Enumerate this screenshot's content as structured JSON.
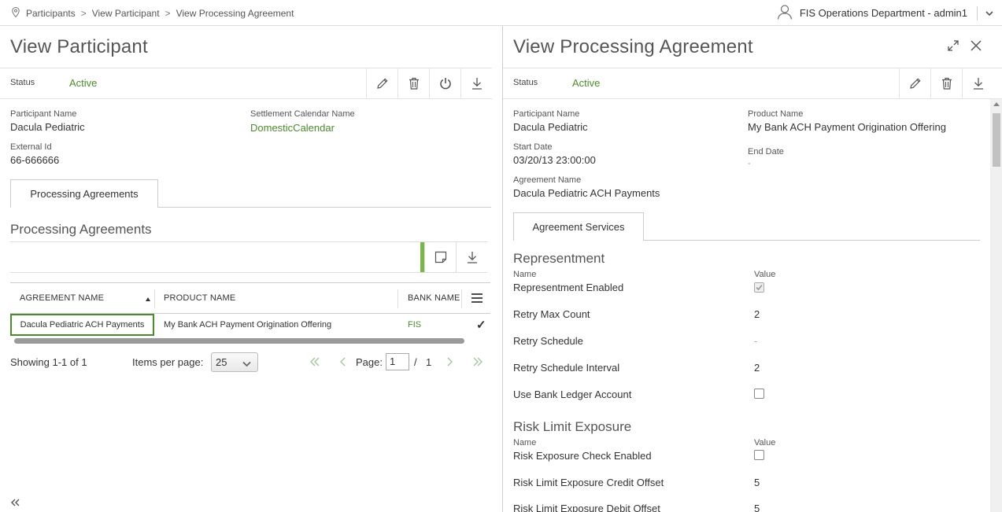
{
  "breadcrumb": [
    "Participants",
    "View Participant",
    "View Processing Agreement"
  ],
  "user": {
    "label": "FIS Operations Department - admin1"
  },
  "left": {
    "title": "View Participant",
    "status_label": "Status",
    "status_value": "Active",
    "participant_name_label": "Participant Name",
    "participant_name": "Dacula Pediatric",
    "settlement_calendar_label": "Settlement Calendar Name",
    "settlement_calendar": "DomesticCalendar",
    "external_id_label": "External Id",
    "external_id": "66-666666",
    "tab": "Processing Agreements",
    "section_title": "Processing Agreements",
    "grid": {
      "columns": [
        "AGREEMENT NAME",
        "PRODUCT NAME",
        "BANK NAME"
      ],
      "rows": [
        {
          "agreement_name": "Dacula Pediatric ACH Payments",
          "product_name": "My Bank ACH Payment Origination Offering",
          "bank_name": "FIS",
          "checked": "✓"
        }
      ]
    },
    "pager": {
      "showing": "Showing 1-1 of 1",
      "items_per_page_label": "Items per page:",
      "items_per_page": "25",
      "page_label": "Page:",
      "page": "1",
      "slash": "/",
      "total_pages": "1"
    }
  },
  "right": {
    "title": "View Processing Agreement",
    "status_label": "Status",
    "status_value": "Active",
    "participant_name_label": "Participant Name",
    "participant_name": "Dacula Pediatric",
    "product_name_label": "Product Name",
    "product_name": "My Bank ACH Payment Origination Offering",
    "start_date_label": "Start Date",
    "start_date": "03/20/13 23:00:00",
    "end_date_label": "End Date",
    "end_date": "-",
    "agreement_name_label": "Agreement Name",
    "agreement_name": "Dacula Pediatric ACH Payments",
    "tab": "Agreement Services",
    "representment": {
      "title": "Representment",
      "name_header": "Name",
      "value_header": "Value",
      "rows": [
        {
          "name": "Representment Enabled",
          "value": "",
          "checkbox": true,
          "checked": true
        },
        {
          "name": "Retry Max Count",
          "value": "2"
        },
        {
          "name": "Retry Schedule",
          "value": "-"
        },
        {
          "name": "Retry Schedule Interval",
          "value": "2"
        },
        {
          "name": "Use Bank Ledger Account",
          "value": "",
          "checkbox": true,
          "checked": false
        }
      ]
    },
    "risk": {
      "title": "Risk Limit Exposure",
      "name_header": "Name",
      "value_header": "Value",
      "rows": [
        {
          "name": "Risk Exposure Check Enabled",
          "value": "",
          "checkbox": true,
          "checked": false
        },
        {
          "name": "Risk Limit Exposure Credit Offset",
          "value": "5"
        },
        {
          "name": "Risk Limit Exposure Debit Offset",
          "value": "5"
        }
      ]
    }
  },
  "colors": {
    "accent_green": "#4a8b2c",
    "bar_green": "#7ab648"
  }
}
